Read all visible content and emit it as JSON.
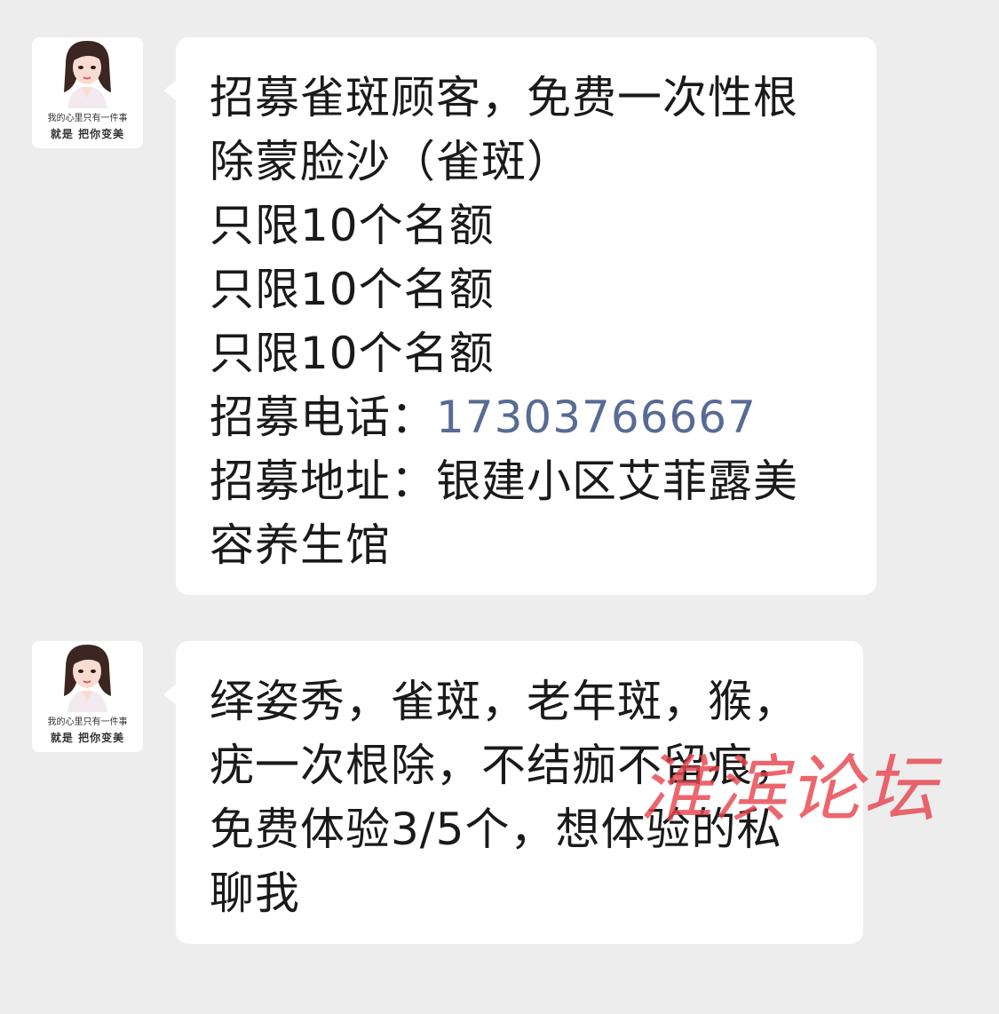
{
  "messages": [
    {
      "avatar": {
        "caption_line1": "我的心里只有一件事",
        "caption_line2": "就是 把你变美"
      },
      "lines": [
        "招募雀斑顾客，免费一次性根",
        "除蒙脸沙（雀斑）",
        "只限10个名额",
        "只限10个名额",
        "只限10个名额"
      ],
      "phone_label": "招募电话：",
      "phone_number": "17303766667",
      "address_lines": [
        "招募地址：银建小区艾菲露美",
        "容养生馆"
      ]
    },
    {
      "avatar": {
        "caption_line1": "我的心里只有一件事",
        "caption_line2": "就是 把你变美"
      },
      "lines": [
        "绎姿秀，雀斑，老年斑，猴，",
        "疣一次根除，不结痂不留痕，",
        "免费体验3/5个，想体验的私",
        "聊我"
      ]
    }
  ],
  "watermark": "淮滨论坛",
  "colors": {
    "background": "#ededed",
    "bubble": "#ffffff",
    "text": "#1a1a1a",
    "link": "#576b95",
    "watermark": "#e8454f"
  }
}
